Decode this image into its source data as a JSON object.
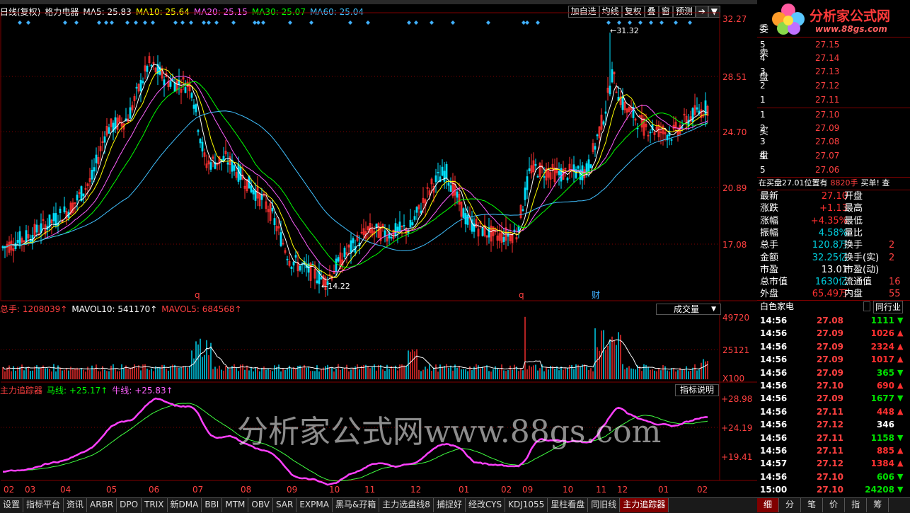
{
  "kline": {
    "header": [
      {
        "text": "日线(复权)",
        "color": "#ffffff"
      },
      {
        "text": "格力电器",
        "color": "#ffffff"
      },
      {
        "text": "MA5: 25.83",
        "color": "#ffffff"
      },
      {
        "text": "MA10: 25.64",
        "color": "#ffff00"
      },
      {
        "text": "MA20: 25.15",
        "color": "#ff60ff"
      },
      {
        "text": "MA30: 25.07",
        "color": "#00ff00"
      },
      {
        "text": "MA60: 25.04",
        "color": "#40c0ff"
      }
    ],
    "toolbar": [
      "加自选",
      "均线",
      "复权",
      "叠",
      "窗",
      "预测"
    ],
    "yticks": [
      "32.27",
      "28.51",
      "24.70",
      "20.89",
      "17.08"
    ],
    "high_label": "31.32",
    "low_label": "14.22",
    "markers": [
      "q",
      "q",
      "财"
    ]
  },
  "volume": {
    "header": [
      {
        "text": "总手: 1208039↑",
        "color": "#ff4040"
      },
      {
        "text": "MAVOL10: 541170↑",
        "color": "#ffffff"
      },
      {
        "text": "MAVOL5: 684568↑",
        "color": "#ff4040"
      }
    ],
    "dropdown": "成交量",
    "yticks": [
      "49720",
      "25121",
      "X100"
    ]
  },
  "indicator": {
    "header": [
      {
        "text": "主力追踪器",
        "color": "#ff4040"
      },
      {
        "text": "马线: +25.17↑",
        "color": "#00ff00"
      },
      {
        "text": "牛线: +25.83↑",
        "color": "#ff60ff"
      }
    ],
    "explain": "指标说明",
    "yticks": [
      "+28.98",
      "+24.19",
      "+19.41"
    ],
    "watermark": "分析家公式网www.88gs.com"
  },
  "xaxis": [
    "02",
    "03",
    "04",
    "05",
    "06",
    "07",
    "08",
    "09",
    "10",
    "11",
    "12",
    "01",
    "02",
    "09",
    "10",
    "11",
    "12",
    "01",
    "02"
  ],
  "logo": {
    "title": "分析家公式网",
    "url": "www.88gs.com"
  },
  "orderbook": {
    "sell_label": [
      "委",
      "卖",
      "盘"
    ],
    "buy_label": [
      "买",
      "盘"
    ],
    "sell": [
      {
        "lvl": "5",
        "px": "27.15"
      },
      {
        "lvl": "4",
        "px": "27.14"
      },
      {
        "lvl": "3",
        "px": "27.13"
      },
      {
        "lvl": "2",
        "px": "27.12"
      },
      {
        "lvl": "1",
        "px": "27.11"
      }
    ],
    "buy": [
      {
        "lvl": "1",
        "px": "27.10"
      },
      {
        "lvl": "2",
        "px": "27.09"
      },
      {
        "lvl": "3",
        "px": "27.08"
      },
      {
        "lvl": "4",
        "px": "27.07"
      },
      {
        "lvl": "5",
        "px": "27.06"
      }
    ],
    "info": [
      {
        "text": "在买盘27.01位置有",
        "color": "#ffffff"
      },
      {
        "text": "8820手",
        "color": "#ff4040"
      },
      {
        "text": "买单! 查",
        "color": "#ffffff"
      }
    ]
  },
  "stats": [
    {
      "l": "最新",
      "v": "27.10",
      "vc": "up",
      "l2": "开盘"
    },
    {
      "l": "涨跌",
      "v": "+1.13",
      "vc": "up",
      "l2": "最高"
    },
    {
      "l": "涨幅",
      "v": "+4.35%",
      "vc": "up",
      "l2": "最低"
    },
    {
      "l": "振幅",
      "v": "4.58%",
      "vc": "cy",
      "l2": "量比"
    },
    {
      "l": "总手",
      "v": "120.8万",
      "vc": "cy",
      "l2": "换手",
      "v2": "2"
    },
    {
      "l": "金额",
      "v": "32.25亿",
      "vc": "cy",
      "l2": "换手(实)",
      "v2": "2"
    },
    {
      "l": "市盈",
      "v": "13.01",
      "vc": "wh",
      "l2": "市盈(动)"
    },
    {
      "l": "总市值",
      "v": "1630亿",
      "vc": "cy",
      "l2": "流通值",
      "v2": "16"
    },
    {
      "l": "外盘",
      "v": "65.49万",
      "vc": "up",
      "l2": "内盘",
      "v2": "55"
    }
  ],
  "sector": {
    "name": "白色家电",
    "right": "同行业"
  },
  "trades": [
    {
      "t": "14:56",
      "p": "27.08",
      "v": "1111",
      "d": "dn"
    },
    {
      "t": "14:56",
      "p": "27.09",
      "v": "1026",
      "d": "up"
    },
    {
      "t": "14:56",
      "p": "27.09",
      "v": "2324",
      "d": "up"
    },
    {
      "t": "14:56",
      "p": "27.09",
      "v": "1017",
      "d": "up"
    },
    {
      "t": "14:56",
      "p": "27.09",
      "v": "365",
      "d": "dn"
    },
    {
      "t": "14:56",
      "p": "27.10",
      "v": "690",
      "d": "up"
    },
    {
      "t": "14:56",
      "p": "27.09",
      "v": "1677",
      "d": "dn"
    },
    {
      "t": "14:56",
      "p": "27.11",
      "v": "448",
      "d": "up"
    },
    {
      "t": "14:56",
      "p": "27.12",
      "v": "346",
      "d": "wh"
    },
    {
      "t": "14:56",
      "p": "27.11",
      "v": "1158",
      "d": "dn"
    },
    {
      "t": "14:56",
      "p": "27.11",
      "v": "885",
      "d": "up"
    },
    {
      "t": "14:57",
      "p": "27.12",
      "v": "1384",
      "d": "up"
    },
    {
      "t": "14:56",
      "p": "27.10",
      "v": "606",
      "d": "dn"
    },
    {
      "t": "15:00",
      "p": "27.10",
      "v": "24208",
      "d": "dn"
    }
  ],
  "bottom_tabs": [
    "设置",
    "指标平台",
    "资讯",
    "ARBR",
    "DPO",
    "TRIX",
    "新DMA",
    "BBI",
    "MTM",
    "OBV",
    "SAR",
    "EXPMA",
    "黑马&孖箱",
    "主力选盘线8",
    "捕捉好",
    "经改CYS",
    "KDJ1055",
    "里柱看盘",
    "同旧线",
    "主力追踪器"
  ],
  "rt_tabs": [
    "细",
    "分",
    "笔",
    "价",
    "指",
    "筹"
  ],
  "colors": {
    "up": "#ff3030",
    "down": "#00e0ff",
    "grid": "#800000"
  }
}
